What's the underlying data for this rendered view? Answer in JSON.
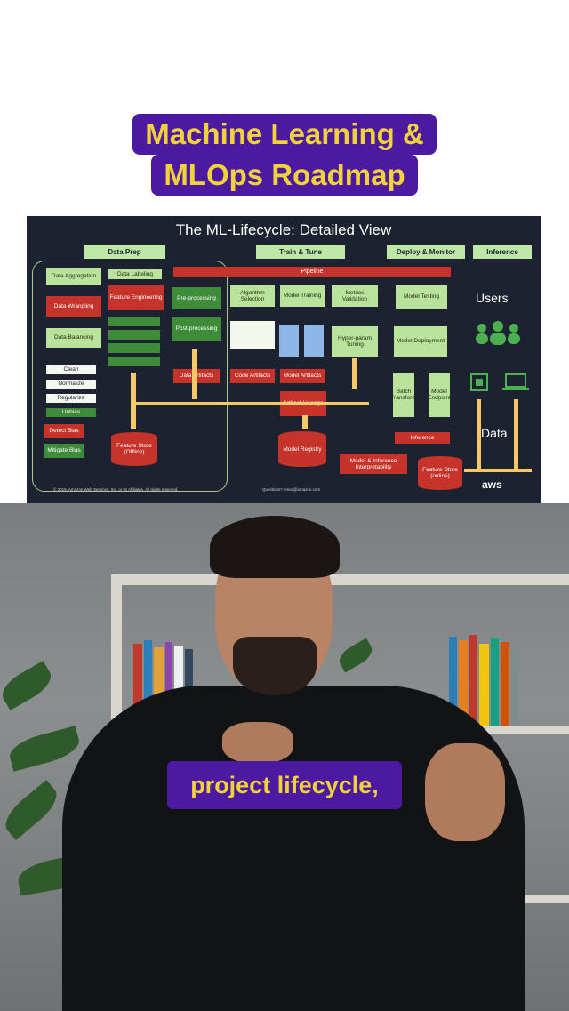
{
  "title": {
    "line1": "Machine Learning &",
    "line2": "MLOps Roadmap"
  },
  "slide": {
    "title": "The ML-Lifecycle: Detailed View",
    "phases": {
      "data_prep": "Data Prep",
      "train_tune": "Train & Tune",
      "deploy_monitor": "Deploy & Monitor",
      "inference": "Inference"
    },
    "pipeline": "Pipeline",
    "boxes": {
      "data_aggregation": "Data Aggregation",
      "data_labeling": "Data Labeling",
      "data_wrangling": "Data Wrangling",
      "feature_engineering": "Feature Engineering",
      "pre_processing": "Pre-processing",
      "algorithm_selection": "Algorithm Selection",
      "model_training": "Model Training",
      "metrics_validation": "Metrics Validation",
      "model_testing": "Model Testing",
      "data_balancing": "Data Balancing",
      "post_processing": "Post-processing",
      "hyperparam_tuning": "Hyper-param Tuning",
      "model_deployment": "Model Deployment",
      "clean": "Clean",
      "normalize": "Normalize",
      "regularize": "Regularize",
      "unbias": "Unbias",
      "detect_bias": "Detect Bias",
      "mitigate_bias": "Mitigate Bias",
      "feature_store_offline": "Feature Store (Offline)",
      "artifact_lineage": "Artifact Lineage",
      "model_registry": "Model Registry",
      "inference": "Inference",
      "interpretability": "Model & Inference Interpretability",
      "feature_store_online": "Feature Store (online)",
      "batch_transform": "Batch Transform",
      "model_endpoint": "Model Endpoint",
      "code_artifacts": "Code Artifacts",
      "model_artifacts": "Model Artifacts",
      "data_artifacts": "Data Artifacts"
    },
    "users": "Users",
    "data": "Data",
    "aws": "aws",
    "copyright": "© 2019, Amazon Web Services, Inc. or its Affiliates. All rights reserved.",
    "contact": "Questions? email@amazon.com"
  },
  "caption": "project lifecycle,"
}
